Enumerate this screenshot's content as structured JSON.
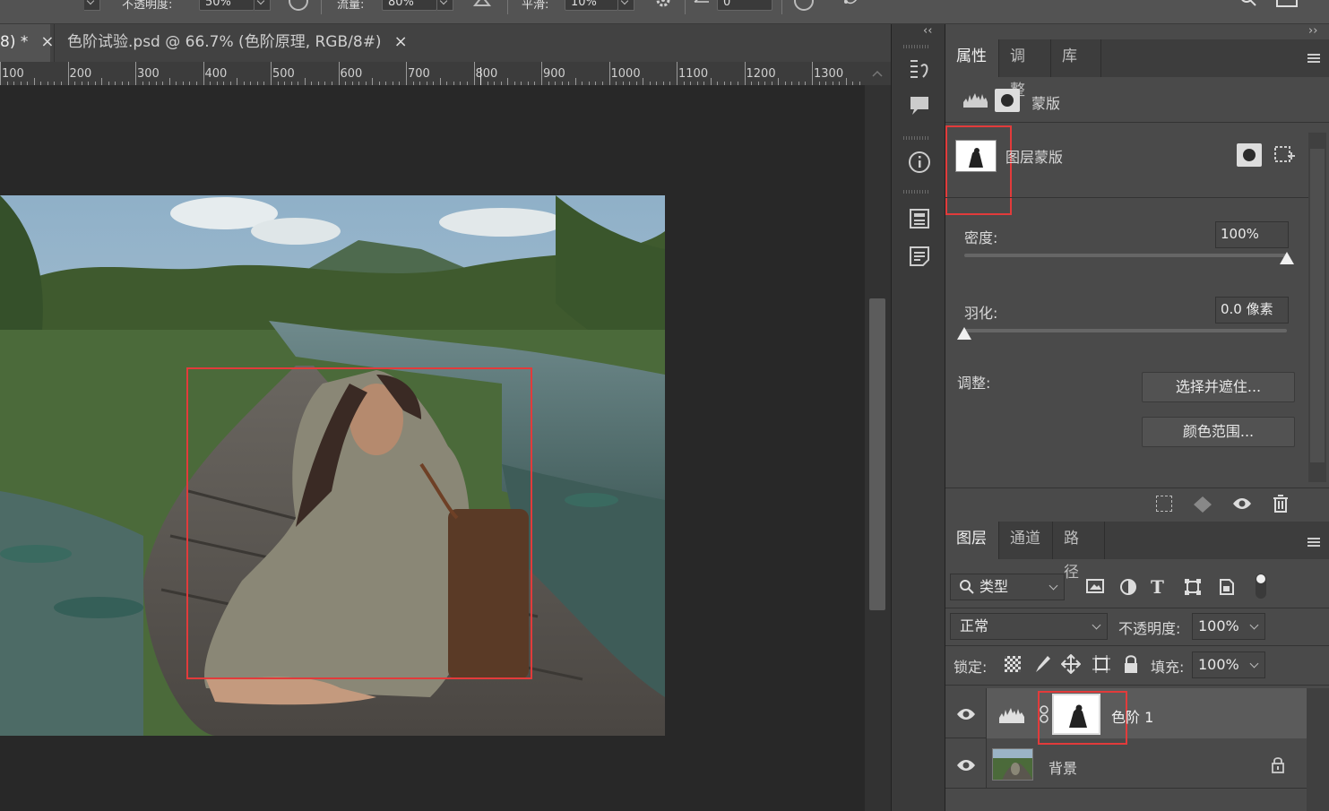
{
  "options_bar": {
    "opacity_label": "不透明度:",
    "opacity_value": "50%",
    "flow_label": "流量:",
    "flow_value": "80%",
    "smoothing_label": "平滑:",
    "smoothing_value": "10%",
    "angle_value": "0"
  },
  "tabs": [
    {
      "label": "8) *",
      "active": true
    },
    {
      "label": "色阶试验.psd @ 66.7% (色阶原理, RGB/8#)",
      "active": false
    }
  ],
  "ruler": {
    "labels": [
      "100",
      "200",
      "300",
      "400",
      "500",
      "600",
      "700",
      "800",
      "900",
      "1000",
      "1100",
      "1200",
      "1300"
    ]
  },
  "properties_panel": {
    "tabs": [
      "属性",
      "调整",
      "库"
    ],
    "active_tab": "属性",
    "header_label": "蒙版",
    "mask_type": "图层蒙版",
    "density_label": "密度:",
    "density_value": "100%",
    "density_level": 1.0,
    "feather_label": "羽化:",
    "feather_value": "0.0 像素",
    "feather_level": 0.0,
    "adjust_label": "调整:",
    "select_and_mask_button": "选择并遮住...",
    "color_range_button": "颜色范围..."
  },
  "layers_panel": {
    "tabs": [
      "图层",
      "通道",
      "路径"
    ],
    "active_tab": "图层",
    "filter_kind": "类型",
    "blend_mode": "正常",
    "opacity_label": "不透明度:",
    "opacity_value": "100%",
    "lock_label": "锁定:",
    "fill_label": "填充:",
    "fill_value": "100%",
    "layers": [
      {
        "name": "色阶 1",
        "type": "adjustment",
        "selected": true,
        "visible": true,
        "has_mask": true
      },
      {
        "name": "背景",
        "type": "image",
        "selected": false,
        "visible": true,
        "locked": true
      }
    ]
  },
  "colors": {
    "highlight_red": "#e23b3b",
    "panel_bg": "#4a4a4a",
    "canvas_bg": "#282828"
  }
}
